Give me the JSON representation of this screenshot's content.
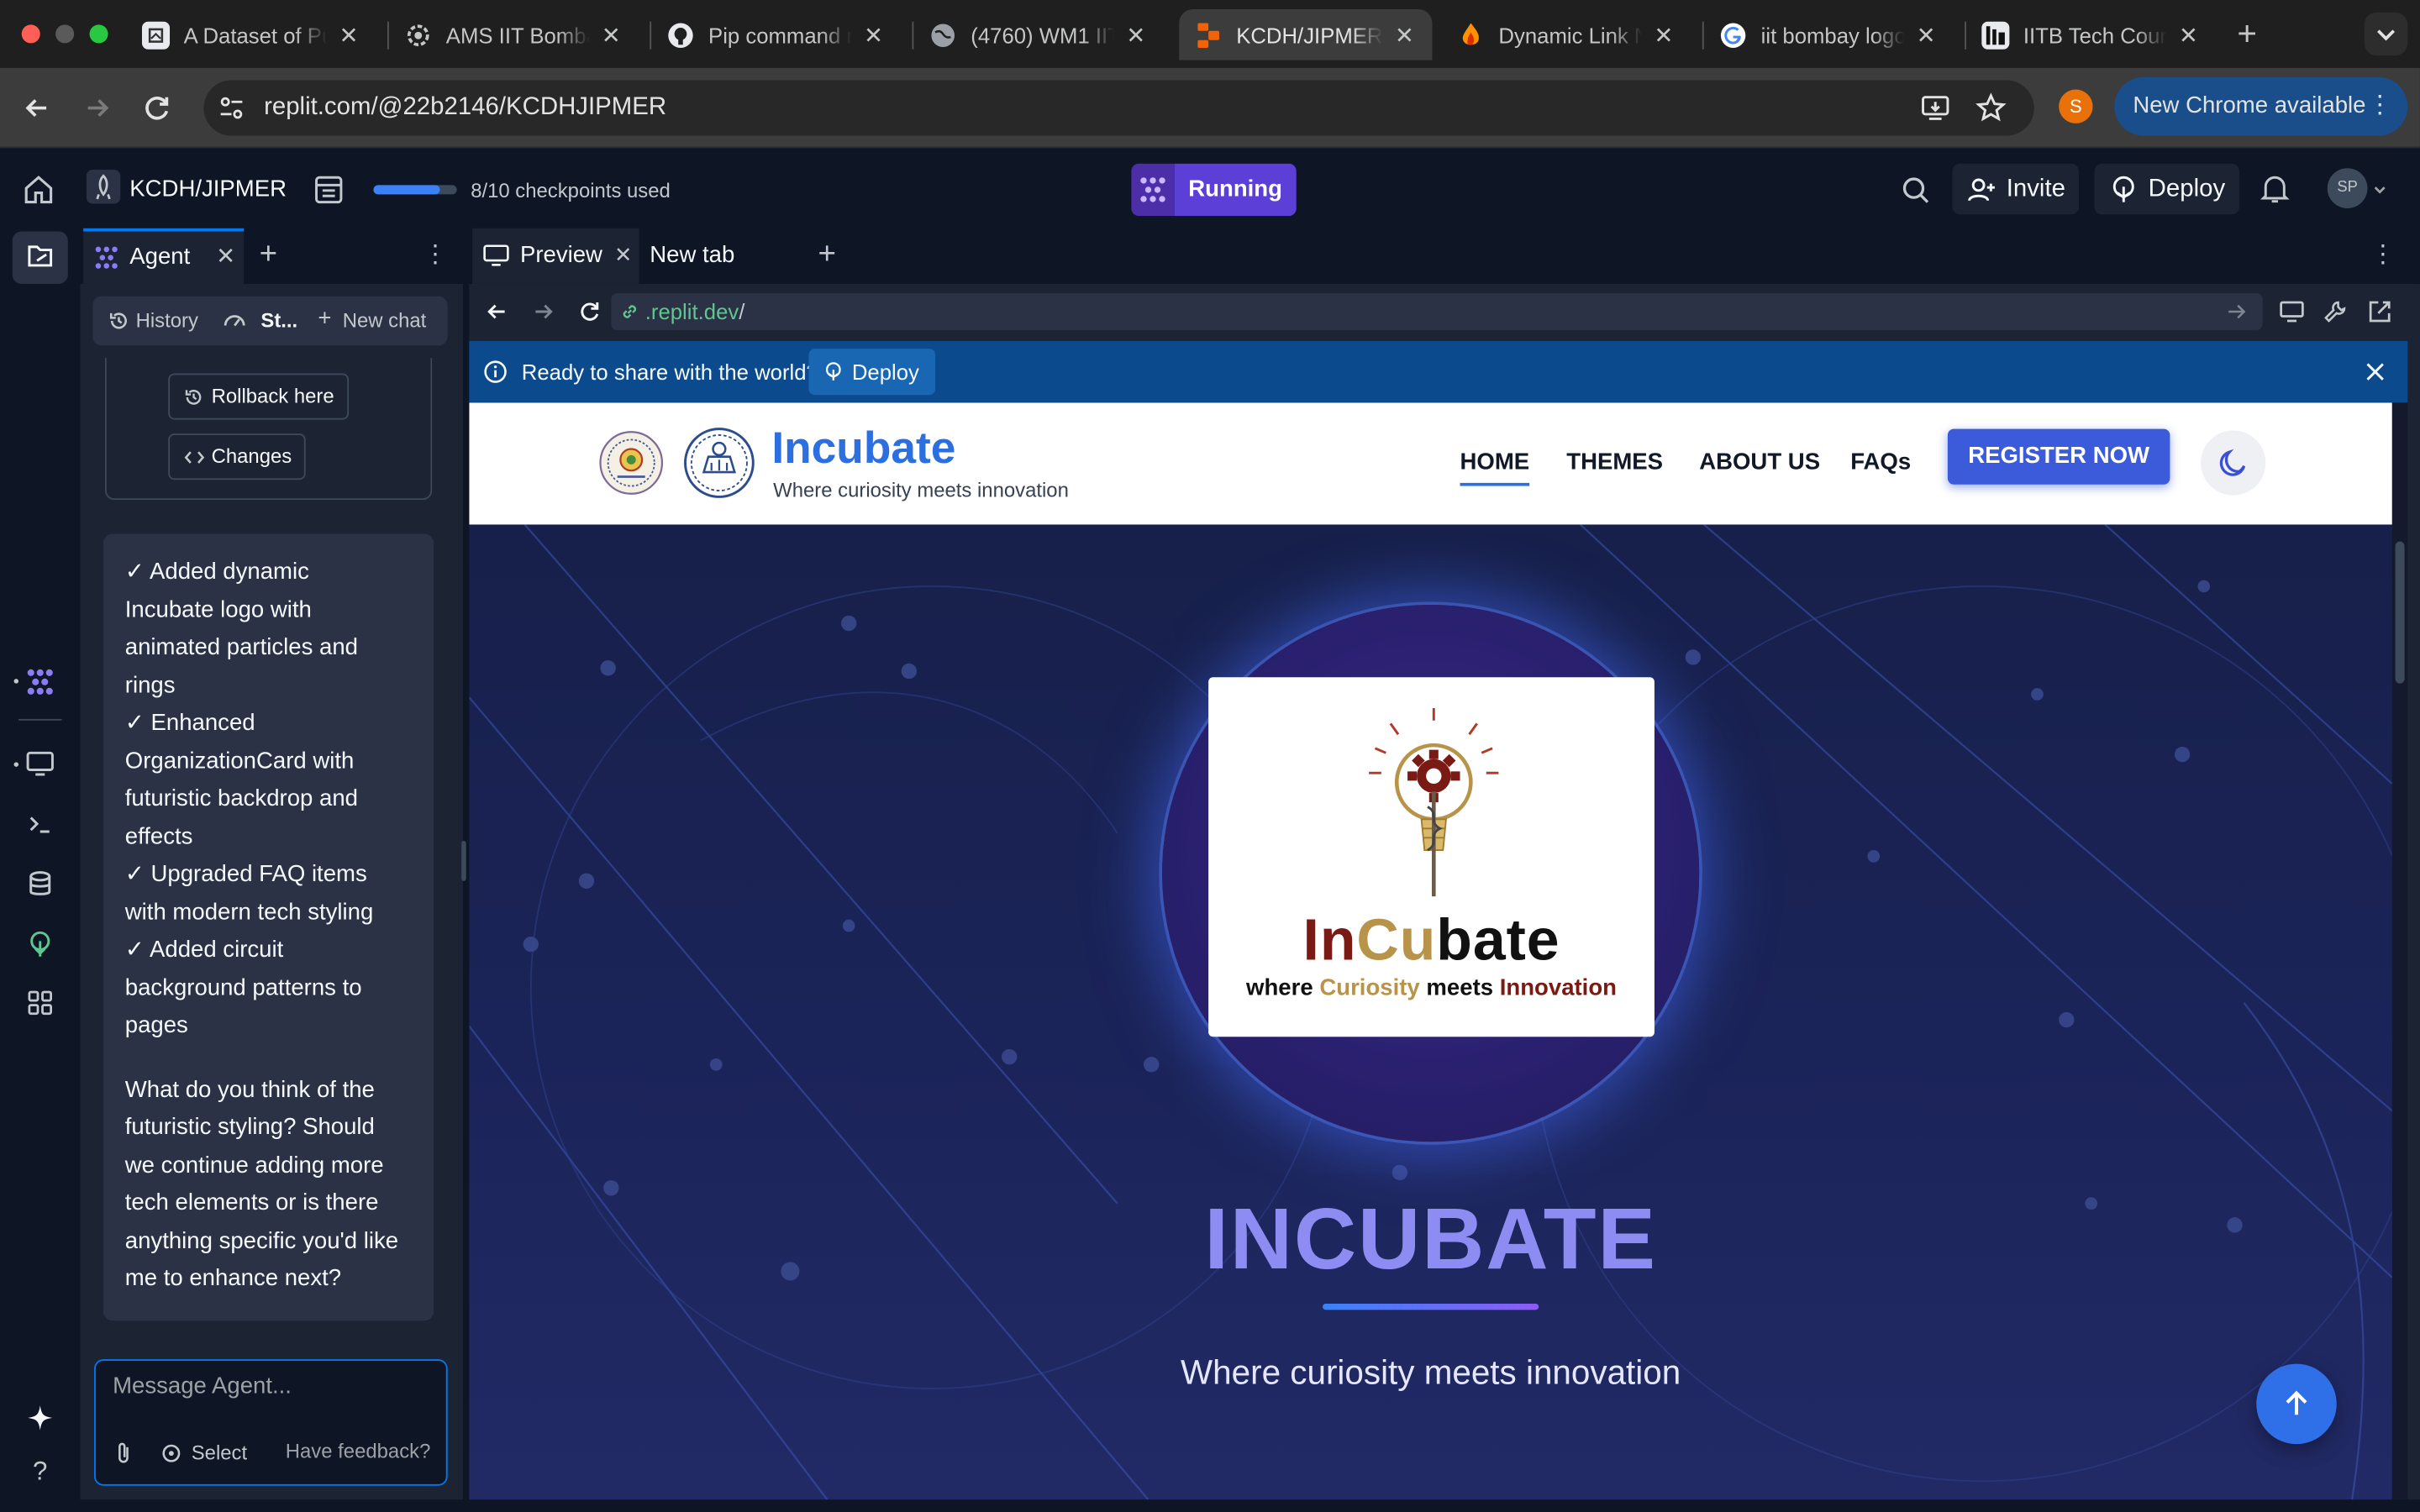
{
  "browser": {
    "tabs": [
      {
        "title": "A Dataset of Pu"
      },
      {
        "title": "AMS IIT Bomba"
      },
      {
        "title": "Pip command r"
      },
      {
        "title": "(4760) WM1 IIT"
      },
      {
        "title": "KCDH/JIPMER"
      },
      {
        "title": "Dynamic Link N"
      },
      {
        "title": "iit bombay logo"
      },
      {
        "title": "IITB Tech Coun"
      }
    ],
    "url": "replit.com/@22b2146/KCDHJIPMER",
    "profile_initial": "S",
    "update_label": "New Chrome available"
  },
  "replit": {
    "project_name": "KCDH/JIPMER",
    "checkpoints_label": "8/10 checkpoints used",
    "checkpoints_fraction": 0.8,
    "status_label": "Running",
    "invite_label": "Invite",
    "deploy_label": "Deploy",
    "user_initials": "SP"
  },
  "agent": {
    "tab_label": "Agent",
    "history_label": "History",
    "status_label": "St...",
    "new_chat_label": "New chat",
    "rollback_label": "Rollback here",
    "changes_label": "Changes",
    "message_lines": [
      "✓ Added dynamic",
      "Incubate logo with",
      "animated particles and",
      "rings",
      "✓ Enhanced",
      "OrganizationCard with",
      "futuristic backdrop and",
      "effects",
      "✓ Upgraded FAQ items",
      "with modern tech styling",
      "✓ Added circuit",
      "background patterns to",
      "pages"
    ],
    "question_lines": [
      "What do you think of the",
      "futuristic styling? Should",
      "we continue adding more",
      "tech elements or is there",
      "anything specific you'd like",
      "me to enhance next?"
    ],
    "input_placeholder": "Message Agent...",
    "select_label": "Select",
    "feedback_label": "Have feedback?"
  },
  "preview": {
    "tab_preview": "Preview",
    "tab_new": "New tab",
    "url_domain": ".replit.dev",
    "url_path": "/",
    "banner_text": "Ready to share with the world?",
    "banner_deploy": "Deploy"
  },
  "site": {
    "brand": "Incubate",
    "tagline": "Where curiosity meets innovation",
    "nav": [
      "HOME",
      "THEMES",
      "ABOUT US",
      "FAQs"
    ],
    "register_label": "REGISTER NOW",
    "logo_word": {
      "in": "In",
      "cu": "Cu",
      "bate": "bate"
    },
    "logo_tagline": {
      "where": "where",
      "curiosity": "Curiosity",
      "meets": "meets",
      "innovation": "Innovation"
    },
    "hero_title": "INCUBATE",
    "hero_subtitle": "Where curiosity meets innovation"
  },
  "colors": {
    "replit_bg": "#0e1525",
    "panel_bg": "#1c2333",
    "accent_blue": "#0079f2",
    "running_purple": "#5b3fd6",
    "brand_blue": "#2b6fe0",
    "logo_maroon": "#7a1a14",
    "logo_gold": "#b8944a"
  }
}
